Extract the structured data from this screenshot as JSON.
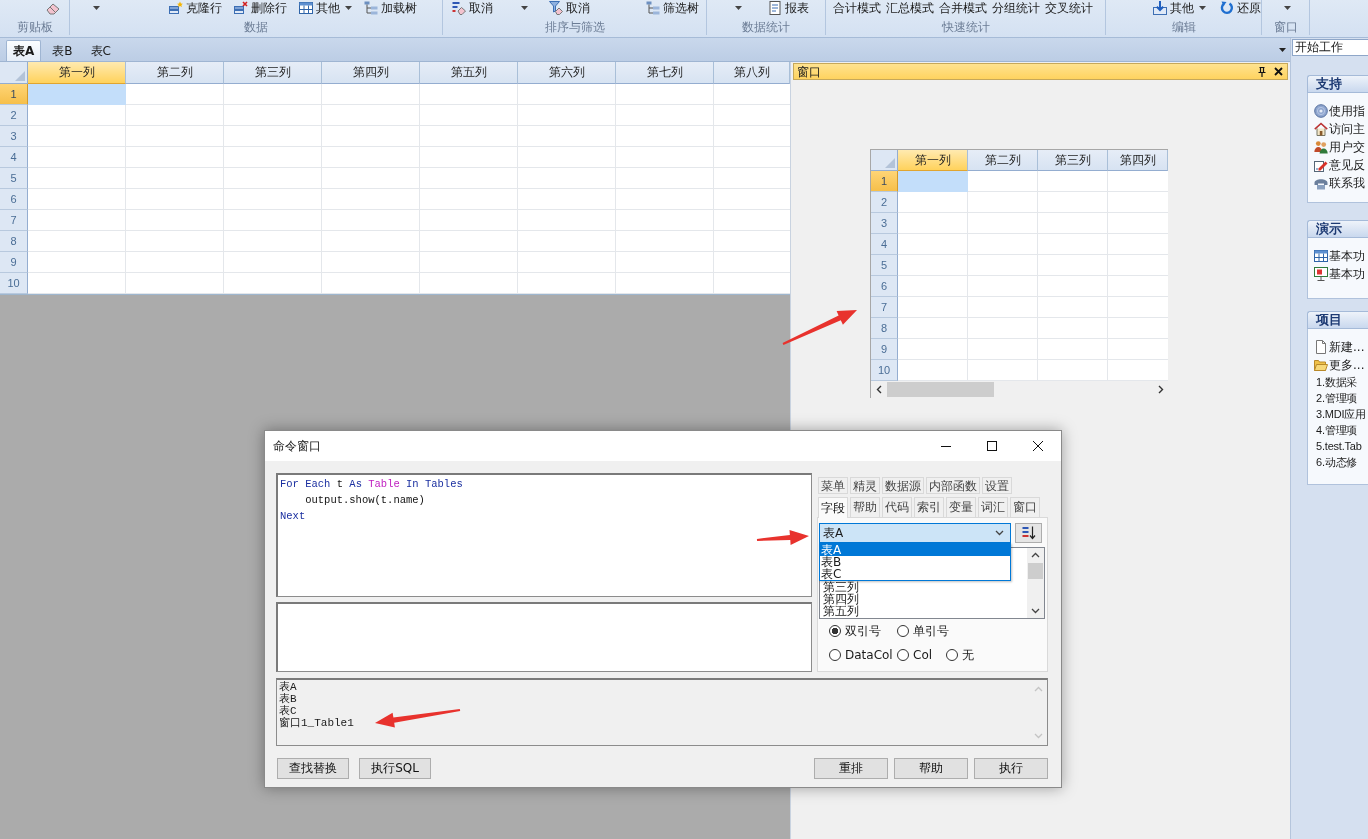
{
  "ribbon": {
    "groups": [
      {
        "label": "剪贴板",
        "items": [
          {
            "kind": "icon"
          }
        ]
      },
      {
        "label": "数据",
        "items": [
          {
            "kind": "caret"
          },
          {
            "kind": "button",
            "label": "克隆行"
          },
          {
            "kind": "button",
            "label": "删除行"
          },
          {
            "kind": "menu",
            "label": "其他"
          },
          {
            "kind": "button",
            "label": "加载树"
          }
        ]
      },
      {
        "label": "排序与筛选",
        "items": [
          {
            "kind": "button",
            "label": "取消"
          },
          {
            "kind": "caret"
          },
          {
            "kind": "button",
            "label": "取消"
          },
          {
            "kind": "button",
            "label": "筛选树"
          }
        ]
      },
      {
        "label": "数据统计",
        "items": [
          {
            "kind": "caret"
          },
          {
            "kind": "button",
            "label": "报表"
          }
        ]
      },
      {
        "label": "快速统计",
        "items": [
          {
            "kind": "text",
            "label": "合计模式"
          },
          {
            "kind": "text",
            "label": "汇总模式"
          },
          {
            "kind": "text",
            "label": "合并模式"
          },
          {
            "kind": "text",
            "label": "分组统计"
          },
          {
            "kind": "text",
            "label": "交叉统计"
          }
        ]
      },
      {
        "label": "编辑",
        "items": [
          {
            "kind": "menu",
            "label": "其他"
          },
          {
            "kind": "button",
            "label": "还原"
          }
        ]
      },
      {
        "label": "窗口",
        "items": [
          {
            "kind": "caret"
          }
        ]
      }
    ]
  },
  "sheet_tabs": [
    {
      "label": "表A",
      "selected": true
    },
    {
      "label": "表B",
      "selected": false
    },
    {
      "label": "表C",
      "selected": false
    }
  ],
  "main_grid": {
    "columns": [
      {
        "label": "第一列",
        "selected": true
      },
      {
        "label": "第二列",
        "selected": false
      },
      {
        "label": "第三列",
        "selected": false
      },
      {
        "label": "第四列",
        "selected": false
      },
      {
        "label": "第五列",
        "selected": false
      },
      {
        "label": "第六列",
        "selected": false
      },
      {
        "label": "第七列",
        "selected": false
      },
      {
        "label": "第八列",
        "selected": false
      }
    ],
    "rows": [
      {
        "label": "1",
        "selected": true
      },
      {
        "label": "2",
        "selected": false
      },
      {
        "label": "3",
        "selected": false
      },
      {
        "label": "4",
        "selected": false
      },
      {
        "label": "5",
        "selected": false
      },
      {
        "label": "6",
        "selected": false
      },
      {
        "label": "7",
        "selected": false
      },
      {
        "label": "8",
        "selected": false
      },
      {
        "label": "9",
        "selected": false
      },
      {
        "label": "10",
        "selected": false
      }
    ]
  },
  "window_panel": {
    "title": "窗口",
    "grid": {
      "columns": [
        {
          "label": "第一列",
          "selected": true
        },
        {
          "label": "第二列",
          "selected": false
        },
        {
          "label": "第三列",
          "selected": false
        },
        {
          "label": "第四列",
          "selected": false
        }
      ],
      "rows": [
        {
          "label": "1",
          "selected": true
        },
        {
          "label": "2",
          "selected": false
        },
        {
          "label": "3",
          "selected": false
        },
        {
          "label": "4",
          "selected": false
        },
        {
          "label": "5",
          "selected": false
        },
        {
          "label": "6",
          "selected": false
        },
        {
          "label": "7",
          "selected": false
        },
        {
          "label": "8",
          "selected": false
        },
        {
          "label": "9",
          "selected": false
        },
        {
          "label": "10",
          "selected": false
        }
      ]
    }
  },
  "task_pane": {
    "title": "开始工作",
    "panels": [
      {
        "title": "支持",
        "items": [
          {
            "kind": "link",
            "label": "使用指"
          },
          {
            "kind": "link",
            "label": "访问主"
          },
          {
            "kind": "link",
            "label": "用户交"
          },
          {
            "kind": "link",
            "label": "意见反"
          },
          {
            "kind": "link",
            "label": "联系我"
          }
        ]
      },
      {
        "title": "演示",
        "items": [
          {
            "kind": "link",
            "label": "基本功"
          },
          {
            "kind": "link",
            "label": "基本功"
          }
        ]
      },
      {
        "title": "项目",
        "items": [
          {
            "kind": "link",
            "label": "新建..."
          },
          {
            "kind": "link",
            "label": "更多..."
          },
          {
            "kind": "recent",
            "label": "1.数据采"
          },
          {
            "kind": "recent",
            "label": "2.管理项"
          },
          {
            "kind": "recent",
            "label": "3.MDI应用"
          },
          {
            "kind": "recent",
            "label": "4.管理项"
          },
          {
            "kind": "recent",
            "label": "5.test.Tab"
          },
          {
            "kind": "recent",
            "label": "6.动态修"
          }
        ]
      }
    ]
  },
  "command_window": {
    "title": "命令窗口",
    "code_lines": [
      {
        "tokens": [
          {
            "text": "For",
            "kind": "keyword"
          },
          {
            "text": "Each",
            "kind": "keyword"
          },
          {
            "text": "t",
            "kind": "plain"
          },
          {
            "text": "As",
            "kind": "keyword"
          },
          {
            "text": "Table",
            "kind": "type"
          },
          {
            "text": "In",
            "kind": "keyword"
          },
          {
            "text": "Tables",
            "kind": "keyword"
          }
        ]
      },
      {
        "tokens": [
          {
            "text": "    output.show(t.name)",
            "kind": "plain"
          }
        ]
      },
      {
        "tokens": [
          {
            "text": "Next",
            "kind": "keyword"
          }
        ]
      }
    ],
    "tab_rows": [
      {
        "tabs": [
          {
            "label": "菜单",
            "selected": false
          },
          {
            "label": "精灵",
            "selected": false
          },
          {
            "label": "数据源",
            "selected": false
          },
          {
            "label": "内部函数",
            "selected": false
          },
          {
            "label": "设置",
            "selected": false
          }
        ]
      },
      {
        "tabs": [
          {
            "label": "字段",
            "selected": true
          },
          {
            "label": "帮助",
            "selected": false
          },
          {
            "label": "代码",
            "selected": false
          },
          {
            "label": "索引",
            "selected": false
          },
          {
            "label": "变量",
            "selected": false
          },
          {
            "label": "词汇",
            "selected": false
          },
          {
            "label": "窗口",
            "selected": false
          }
        ]
      }
    ],
    "table_select": {
      "value": "表A",
      "expanded": true,
      "options": [
        {
          "label": "表A",
          "selected": true
        },
        {
          "label": "表B",
          "selected": false
        },
        {
          "label": "表C",
          "selected": false
        }
      ]
    },
    "field_list": [
      "第三列",
      "第四列",
      "第五列"
    ],
    "radio_rows": [
      {
        "options": [
          {
            "label": "双引号",
            "selected": true
          },
          {
            "label": "单引号",
            "selected": false
          }
        ]
      },
      {
        "options": [
          {
            "label": "DataCol",
            "selected": false
          },
          {
            "label": "Col",
            "selected": false
          },
          {
            "label": "无",
            "selected": false
          }
        ]
      }
    ],
    "output_lines": [
      "表A",
      "表B",
      "表C",
      "窗口1_Table1"
    ],
    "buttons_left": [
      "查找替换",
      "执行SQL"
    ],
    "buttons_right": [
      "重排",
      "帮助",
      "执行"
    ]
  }
}
